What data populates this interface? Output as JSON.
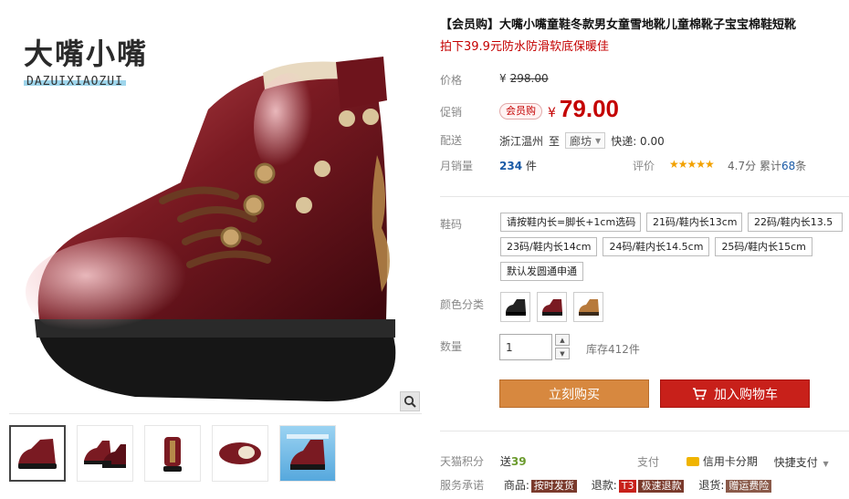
{
  "brand": {
    "cn": "大嘴小嘴",
    "en": "DAZUIXIAOZUI"
  },
  "gallery": {
    "thumb_count": 5,
    "active_thumb": 0
  },
  "product": {
    "title": "【会员购】大嘴小嘴童鞋冬款男女童雪地靴儿童棉靴子宝宝棉鞋短靴",
    "subtitle": "拍下39.9元防水防滑软底保暖佳"
  },
  "price": {
    "label": "价格",
    "currency": "¥",
    "original": "298.00",
    "promo_label": "促销",
    "promo_tag": "会员购",
    "current": "79.00"
  },
  "shipping": {
    "label": "配送",
    "from": "浙江温州",
    "to_word": "至",
    "to_city": "廊坊",
    "express": "快递: 0.00"
  },
  "sales": {
    "label": "月销量",
    "count": "234",
    "unit": "件",
    "review_label": "评价",
    "stars": "★★★★★",
    "score": "4.7分",
    "cum_label": "累计",
    "cum_count": "68",
    "cum_unit": "条"
  },
  "sizes": {
    "label": "鞋码",
    "options": [
      "请按鞋内长=脚长+1cm选码",
      "21码/鞋内长13cm",
      "22码/鞋内长13.5",
      "23码/鞋内长14cm",
      "24码/鞋内长14.5cm",
      "25码/鞋内长15cm",
      "默认发圆通申通"
    ]
  },
  "colors": {
    "label": "颜色分类",
    "options": [
      "black",
      "burgundy",
      "tan"
    ]
  },
  "quantity": {
    "label": "数量",
    "value": "1",
    "stock": "库存412件"
  },
  "buttons": {
    "buy": "立刻购买",
    "cart": "加入购物车"
  },
  "footer": {
    "points_label": "天猫积分",
    "points_prefix": "送",
    "points_value": "39",
    "pay_label": "支付",
    "credit": "信用卡分期",
    "quick_pay": "快捷支付",
    "promise_label": "服务承诺",
    "goods_label": "商品:",
    "goods_badge": "按时发货",
    "refund_label": "退款:",
    "refund_badge_t3": "T3",
    "refund_badge": "极速退款",
    "return_label": "退货:",
    "return_badge": "赠运费险"
  },
  "colors_theme": {
    "price_red": "#c40000",
    "buy_orange": "#d7883f",
    "cart_red": "#c8201a",
    "link_blue": "#1a5aa6"
  }
}
